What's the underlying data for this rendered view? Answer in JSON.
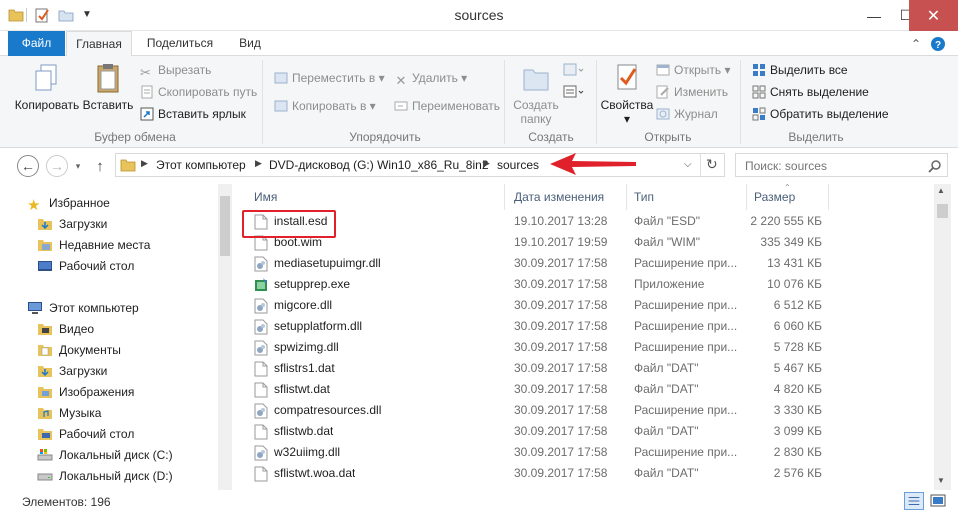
{
  "window": {
    "title": "sources",
    "controls": {
      "minimize": "—",
      "maximize": "☐",
      "close": "✕"
    }
  },
  "ribbon_tabs": {
    "file": "Файл",
    "home": "Главная",
    "share": "Поделиться",
    "view": "Вид"
  },
  "ribbon": {
    "clipboard": {
      "label": "Буфер обмена",
      "copy": "Копировать",
      "paste": "Вставить",
      "cut": "Вырезать",
      "copy_path": "Скопировать путь",
      "paste_shortcut": "Вставить ярлык"
    },
    "organize": {
      "label": "Упорядочить",
      "move_to": "Переместить в",
      "copy_to": "Копировать в",
      "delete": "Удалить",
      "rename": "Переименовать"
    },
    "new": {
      "label": "Создать",
      "new_folder_line1": "Создать",
      "new_folder_line2": "папку"
    },
    "open": {
      "label": "Открыть",
      "properties": "Свойства",
      "open": "Открыть",
      "edit": "Изменить",
      "history": "Журнал"
    },
    "select": {
      "label": "Выделить",
      "select_all": "Выделить все",
      "select_none": "Снять выделение",
      "invert": "Обратить выделение"
    }
  },
  "address": {
    "crumbs": [
      "Этот компьютер",
      "DVD-дисковод (G:) Win10_x86_Ru_8in2",
      "sources"
    ],
    "search_placeholder": "Поиск: sources"
  },
  "nav": {
    "favorites": "Избранное",
    "favorites_items": [
      "Загрузки",
      "Недавние места",
      "Рабочий стол"
    ],
    "computer": "Этот компьютер",
    "computer_items": [
      "Видео",
      "Документы",
      "Загрузки",
      "Изображения",
      "Музыка",
      "Рабочий стол",
      "Локальный диск (C:)",
      "Локальный диск (D:)"
    ]
  },
  "columns": {
    "name": "Имя",
    "date": "Дата изменения",
    "type": "Тип",
    "size": "Размер"
  },
  "files": [
    {
      "name": "install.esd",
      "date": "19.10.2017 13:28",
      "type": "Файл \"ESD\"",
      "size": "2 220 555 КБ",
      "icon": "file-icon"
    },
    {
      "name": "boot.wim",
      "date": "19.10.2017 19:59",
      "type": "Файл \"WIM\"",
      "size": "335 349 КБ",
      "icon": "file-icon"
    },
    {
      "name": "mediasetupuimgr.dll",
      "date": "30.09.2017 17:58",
      "type": "Расширение при...",
      "size": "13 431 КБ",
      "icon": "dll-icon"
    },
    {
      "name": "setupprep.exe",
      "date": "30.09.2017 17:58",
      "type": "Приложение",
      "size": "10 076 КБ",
      "icon": "setup-exe-icon"
    },
    {
      "name": "migcore.dll",
      "date": "30.09.2017 17:58",
      "type": "Расширение при...",
      "size": "6 512 КБ",
      "icon": "dll-icon"
    },
    {
      "name": "setupplatform.dll",
      "date": "30.09.2017 17:58",
      "type": "Расширение при...",
      "size": "6 060 КБ",
      "icon": "dll-icon"
    },
    {
      "name": "spwizimg.dll",
      "date": "30.09.2017 17:58",
      "type": "Расширение при...",
      "size": "5 728 КБ",
      "icon": "dll-icon"
    },
    {
      "name": "sflistrs1.dat",
      "date": "30.09.2017 17:58",
      "type": "Файл \"DAT\"",
      "size": "5 467 КБ",
      "icon": "file-icon"
    },
    {
      "name": "sflistwt.dat",
      "date": "30.09.2017 17:58",
      "type": "Файл \"DAT\"",
      "size": "4 820 КБ",
      "icon": "file-icon"
    },
    {
      "name": "compatresources.dll",
      "date": "30.09.2017 17:58",
      "type": "Расширение при...",
      "size": "3 330 КБ",
      "icon": "dll-icon"
    },
    {
      "name": "sflistwb.dat",
      "date": "30.09.2017 17:58",
      "type": "Файл \"DAT\"",
      "size": "3 099 КБ",
      "icon": "file-icon"
    },
    {
      "name": "w32uiimg.dll",
      "date": "30.09.2017 17:58",
      "type": "Расширение при...",
      "size": "2 830 КБ",
      "icon": "dll-icon"
    },
    {
      "name": "sflistwt.woa.dat",
      "date": "30.09.2017 17:58",
      "type": "Файл \"DAT\"",
      "size": "2 576 КБ",
      "icon": "file-icon"
    }
  ],
  "status": {
    "items": "Элементов: 196"
  },
  "colors": {
    "accent": "#1979ca",
    "highlight_red": "#e0212b",
    "close_red": "#c75050",
    "folder_yellow": "#e8c25a"
  }
}
